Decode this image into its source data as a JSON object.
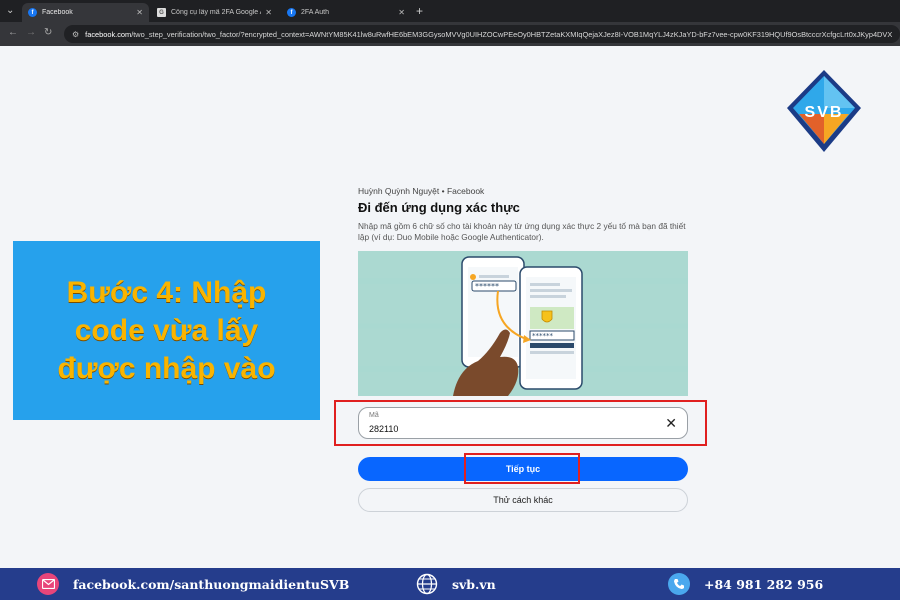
{
  "browser": {
    "tabs": [
      {
        "label": "Facebook",
        "active": true,
        "icon": "facebook-favicon"
      },
      {
        "label": "Công cụ lấy mã 2FA Google Au",
        "active": false,
        "icon": "document-favicon"
      },
      {
        "label": "2FA Auth",
        "active": false,
        "icon": "facebook-favicon"
      }
    ],
    "url_host": "facebook.com",
    "url_path": "/two_step_verification/two_factor/?encrypted_context=AWNtYM85K41lw8uRwfHE6bEM3GGysoMVVg0UIHZOCwPEeOy0HBTZetaKXMIqQejaXJez8I-VOB1MqYLJ4zKJaYD-bFz7vee-cpw0KF319HQUf9OsBtcccrXcfgcLrt0xJKyp4DVX"
  },
  "logo": {
    "text": "SVB"
  },
  "callout": {
    "line1": "Bước 4: Nhập",
    "line2": "code vừa lấy",
    "line3": "được nhập vào",
    "bg": "#26a1ec",
    "text_color": "#f9b400"
  },
  "form": {
    "account": "Huỳnh Quỳnh Nguyệt • Facebook",
    "title": "Đi đến ứng dụng xác thực",
    "description": "Nhập mã gồm 6 chữ số cho tài khoản này từ ứng dụng xác thực 2 yếu tố mà bạn đã thiết lập (ví dụ: Duo Mobile hoặc Google Authenticator).",
    "code_label": "Mã",
    "code_value": "282110",
    "continue_label": "Tiếp tục",
    "other_label": "Thử cách khác",
    "accent": "#0866ff",
    "highlight": "#e02020"
  },
  "footer": {
    "email_text": "facebook.com/santhuongmaidientuSVB",
    "web_text": "svb.vn",
    "phone_text": "+84 981 282 956",
    "bg": "#253d8c"
  }
}
